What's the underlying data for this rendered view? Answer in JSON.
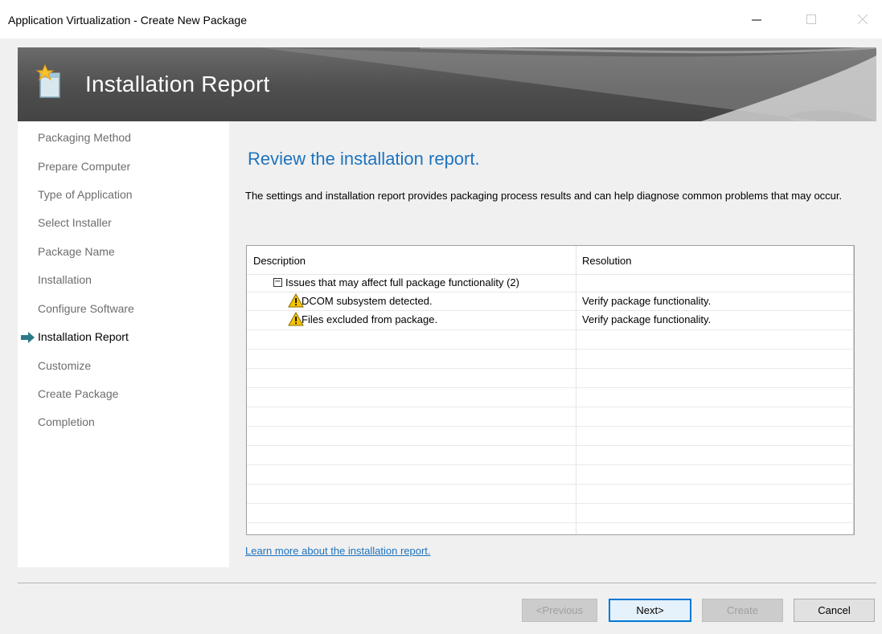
{
  "window": {
    "title": "Application Virtualization - Create New Package",
    "controls": [
      "minimize",
      "maximize",
      "close"
    ]
  },
  "banner": {
    "heading": "Installation Report",
    "icon": "package-sparkle-icon"
  },
  "sidebar": {
    "steps": [
      {
        "label": "Packaging Method"
      },
      {
        "label": "Prepare Computer"
      },
      {
        "label": "Type of Application"
      },
      {
        "label": "Select Installer"
      },
      {
        "label": "Package Name"
      },
      {
        "label": "Installation"
      },
      {
        "label": "Configure Software"
      },
      {
        "label": "Installation Report",
        "current": true
      },
      {
        "label": "Customize"
      },
      {
        "label": "Create Package"
      },
      {
        "label": "Completion"
      }
    ]
  },
  "main": {
    "headline": "Review the installation report.",
    "description": "The settings and installation report provides packaging process results and can help diagnose common problems that may occur.",
    "report": {
      "columns": [
        "Description",
        "Resolution"
      ],
      "group": "Issues that may affect full package functionality (2)",
      "items": [
        {
          "description": "DCOM subsystem detected.",
          "resolution": "Verify package functionality.",
          "icon": "warning-icon"
        },
        {
          "description": "Files excluded from package.",
          "resolution": "Verify package functionality.",
          "icon": "warning-icon"
        }
      ]
    },
    "learn_more": "Learn more about the installation report."
  },
  "footer": {
    "previous": "<Previous",
    "next": "Next>",
    "create": "Create",
    "cancel": "Cancel"
  },
  "colors": {
    "accent": "#1e73be",
    "banner": "#4e4e4e",
    "warning": "#f5c400"
  }
}
